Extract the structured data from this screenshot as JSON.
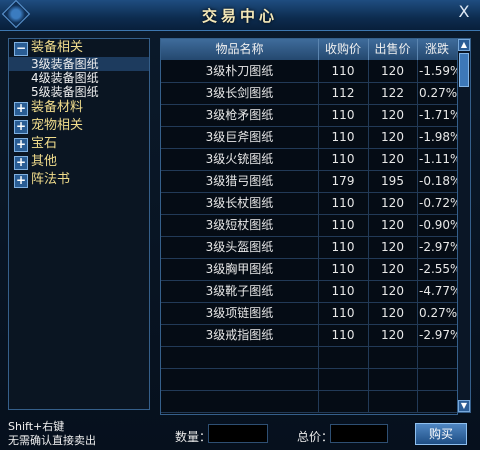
{
  "window": {
    "title": "交易中心",
    "close_label": "X"
  },
  "tree": {
    "categories": [
      {
        "label": "装备相关",
        "state": "−",
        "expanded": true,
        "children": [
          "3级装备图纸",
          "4级装备图纸",
          "5级装备图纸"
        ]
      },
      {
        "label": "装备材料",
        "state": "+"
      },
      {
        "label": "宠物相关",
        "state": "+"
      },
      {
        "label": "宝石",
        "state": "+"
      },
      {
        "label": "其他",
        "state": "+"
      },
      {
        "label": "阵法书",
        "state": "+"
      }
    ],
    "selected_child": "3级装备图纸"
  },
  "grid": {
    "headers": [
      "物品名称",
      "收购价",
      "出售价",
      "涨跌"
    ],
    "rows": [
      {
        "name": "3级朴刀图纸",
        "buy": "110",
        "sell": "120",
        "change": "-1.59%"
      },
      {
        "name": "3级长剑图纸",
        "buy": "112",
        "sell": "122",
        "change": "0.27%"
      },
      {
        "name": "3级枪矛图纸",
        "buy": "110",
        "sell": "120",
        "change": "-1.71%"
      },
      {
        "name": "3级巨斧图纸",
        "buy": "110",
        "sell": "120",
        "change": "-1.98%"
      },
      {
        "name": "3级火铳图纸",
        "buy": "110",
        "sell": "120",
        "change": "-1.11%"
      },
      {
        "name": "3级猎弓图纸",
        "buy": "179",
        "sell": "195",
        "change": "-0.18%"
      },
      {
        "name": "3级长杖图纸",
        "buy": "110",
        "sell": "120",
        "change": "-0.72%"
      },
      {
        "name": "3级短杖图纸",
        "buy": "110",
        "sell": "120",
        "change": "-0.90%"
      },
      {
        "name": "3级头盔图纸",
        "buy": "110",
        "sell": "120",
        "change": "-2.97%"
      },
      {
        "name": "3级胸甲图纸",
        "buy": "110",
        "sell": "120",
        "change": "-2.55%"
      },
      {
        "name": "3级靴子图纸",
        "buy": "110",
        "sell": "120",
        "change": "-4.77%"
      },
      {
        "name": "3级项链图纸",
        "buy": "110",
        "sell": "120",
        "change": "0.27%"
      },
      {
        "name": "3级戒指图纸",
        "buy": "110",
        "sell": "120",
        "change": "-2.97%"
      }
    ],
    "empty_rows": 3
  },
  "footer": {
    "hint_line1": "Shift+右键",
    "hint_line2": "无需确认直接卖出",
    "quantity_label": "数量：",
    "quantity_value": "",
    "total_label": "总价：",
    "total_value": "",
    "buy_label": "购买"
  },
  "colors": {
    "category_text": "#f0dc8c",
    "header_bg": "#3f6c9b",
    "panel_border": "#355f8a"
  }
}
